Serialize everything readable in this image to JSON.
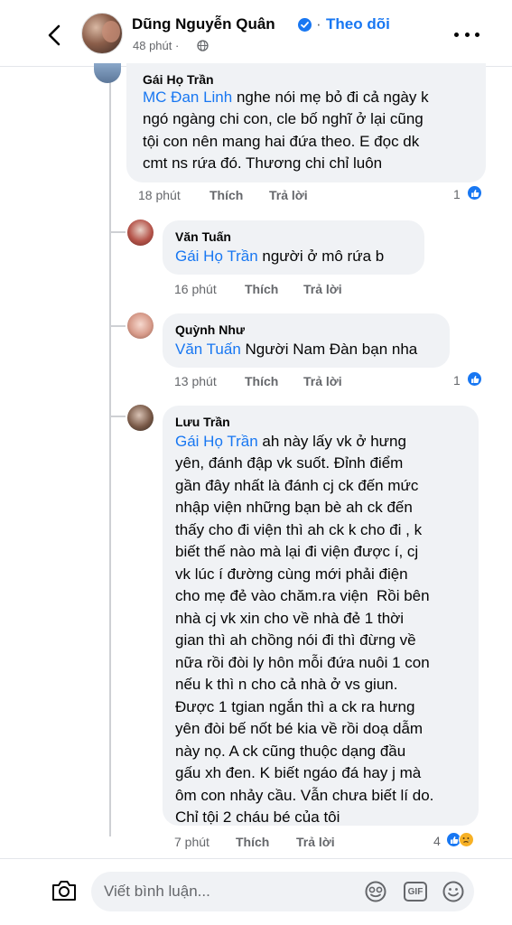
{
  "header": {
    "name": "Dũng Nguyễn Quân",
    "separator": "·",
    "follow_label": "Theo dõi",
    "time": "48 phút ·",
    "icons": [
      "back-arrow-icon",
      "verified-badge-icon",
      "globe-icon",
      "more-dots-icon"
    ]
  },
  "comments": [
    {
      "author": "Gái Họ Trần",
      "mention": "MC Đan Linh",
      "text_first": " nghe nói mẹ bỏ đi cả ngày k",
      "text_rest": "ngó ngàng chi con, cle bố nghĩ ở lại cũng\ntội con nên mang hai đứa theo. E đọc dk\ncmt ns rứa đó. Thương chi chỉ luôn",
      "time": "18 phút",
      "like_label": "Thích",
      "reply_label": "Trả lời",
      "reaction_count": "1",
      "reactions": [
        "like-icon"
      ]
    },
    {
      "author": "Văn Tuấn",
      "mention": "Gái Họ Trần",
      "text_first": " người ở mô rứa b",
      "text_rest": "",
      "time": "16 phút",
      "like_label": "Thích",
      "reply_label": "Trả lời",
      "reaction_count": "",
      "reactions": []
    },
    {
      "author": "Quỳnh Như",
      "mention": "Văn Tuấn",
      "text_first": " Người Nam Đàn bạn nha",
      "text_rest": "",
      "time": "13 phút",
      "like_label": "Thích",
      "reply_label": "Trả lời",
      "reaction_count": "1",
      "reactions": [
        "like-icon"
      ]
    },
    {
      "author": "Lưu Trần",
      "mention": "Gái Họ Trần",
      "text_first": " ah này lấy vk ở hưng",
      "text_rest": "yên, đánh đập vk suốt. Đỉnh điểm\ngần đây nhất là đánh cj ck đến mức\nnhập viện những bạn bè ah ck đến\nthấy cho đi viện thì ah ck k cho đi , k\nbiết thế nào mà lại đi viện được í, cj\nvk lúc í đường cùng mới phải điện\ncho mẹ đẻ vào chăm.ra viện  Rồi bên\nnhà cj vk xin cho về nhà đẻ 1 thời\ngian thì ah chồng nói đi thì đừng về\nnữa rồi đòi ly hôn mỗi đứa nuôi 1 con\nnếu k thì n cho cả nhà ở vs giun.\nĐược 1 tgian ngắn thì a ck ra hưng\nyên đòi bế nốt bé kia về rồi doạ dẫm\nnày nọ. A ck cũng thuộc dạng đầu\ngấu xh đen. K biết ngáo đá hay j mà\nôm con nhảy cầu. Vẫn chưa biết lí do.\nChỉ tội 2 cháu bé của tôi",
      "time": "7 phút",
      "like_label": "Thích",
      "reply_label": "Trả lời",
      "reaction_count": "4",
      "reactions": [
        "like-icon",
        "sad-icon"
      ]
    }
  ],
  "footer": {
    "comment_placeholder": "Viết bình luận...",
    "gif_label": "GIF",
    "icons": [
      "camera-icon",
      "sticker-icon",
      "gif-icon",
      "emoji-icon"
    ]
  },
  "colors": {
    "accent": "#1877f2",
    "bubble": "#f0f2f5",
    "meta_text": "#65676b",
    "sad_reaction": "#f7b125"
  }
}
